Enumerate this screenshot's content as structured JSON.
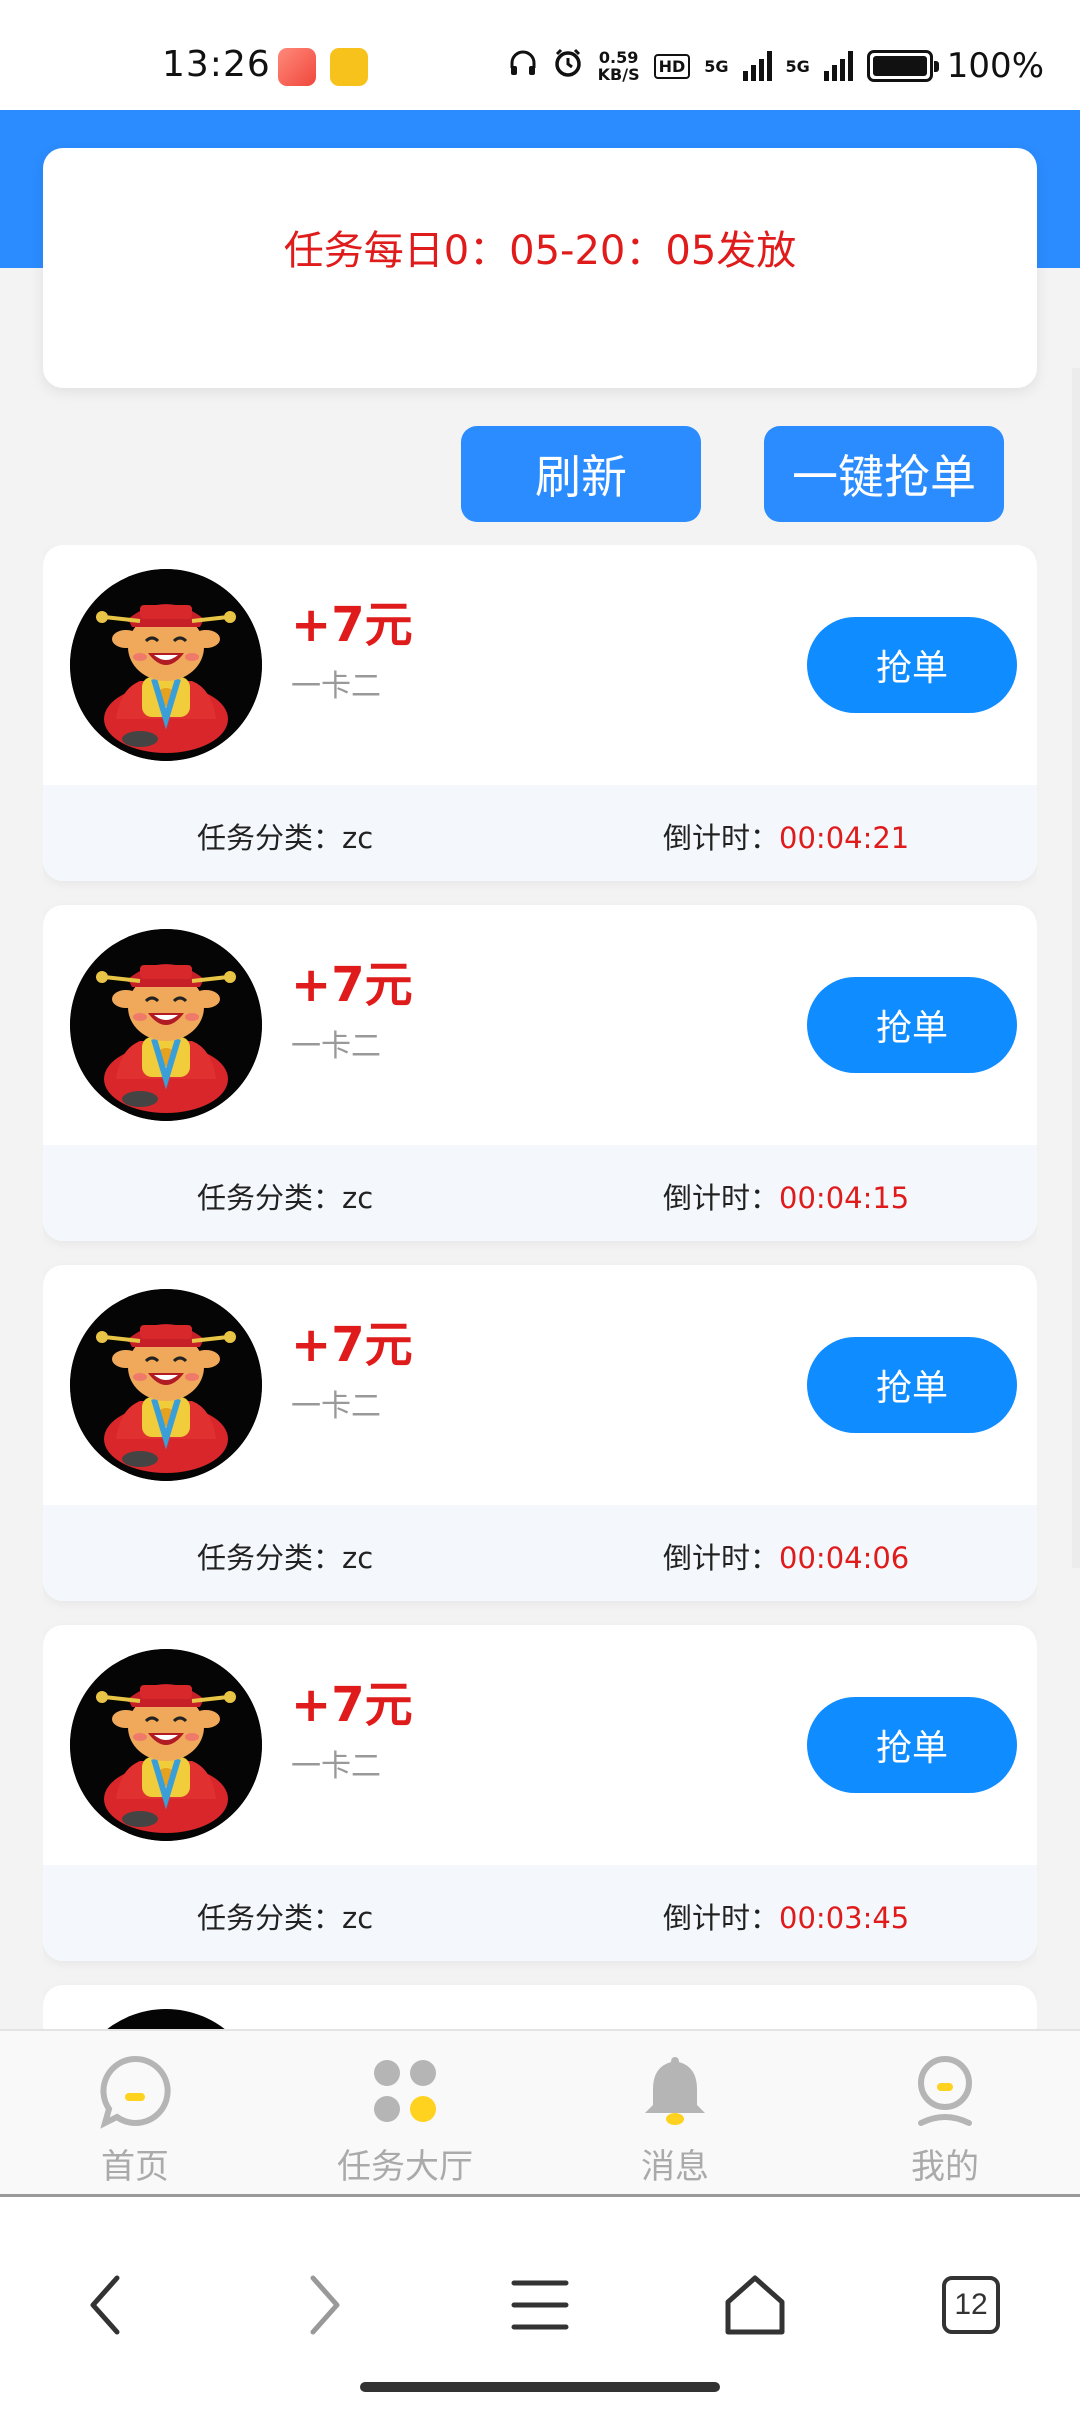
{
  "status_bar": {
    "time": "13:26",
    "network_speed_value": "0.59",
    "network_speed_unit": "KB/S",
    "hd_badge": "HD",
    "signal_1": "5G",
    "signal_2": "5G",
    "battery_percent": "100%"
  },
  "colors": {
    "primary_blue": "#2b8cff",
    "grab_blue": "#0f8cff",
    "accent_red": "#e01b1b",
    "hall_dot_yellow": "#ffd21f"
  },
  "notice": {
    "text": "任务每日0：05-20：05发放"
  },
  "actions": {
    "refresh_label": "刷新",
    "grab_all_label": "一键抢单"
  },
  "tasks": [
    {
      "reward": "+7元",
      "subtitle": "一卡二",
      "grab_label": "抢单",
      "category_label": "任务分类：",
      "category_value": "zc",
      "countdown_label": "倒计时：",
      "countdown_value": "00:04:21"
    },
    {
      "reward": "+7元",
      "subtitle": "一卡二",
      "grab_label": "抢单",
      "category_label": "任务分类：",
      "category_value": "zc",
      "countdown_label": "倒计时：",
      "countdown_value": "00:04:15"
    },
    {
      "reward": "+7元",
      "subtitle": "一卡二",
      "grab_label": "抢单",
      "category_label": "任务分类：",
      "category_value": "zc",
      "countdown_label": "倒计时：",
      "countdown_value": "00:04:06"
    },
    {
      "reward": "+7元",
      "subtitle": "一卡二",
      "grab_label": "抢单",
      "category_label": "任务分类：",
      "category_value": "zc",
      "countdown_label": "倒计时：",
      "countdown_value": "00:03:45"
    }
  ],
  "tabbar": {
    "items": [
      {
        "label": "首页",
        "icon": "chat-bubble-icon"
      },
      {
        "label": "任务大厅",
        "icon": "task-hall-icon"
      },
      {
        "label": "消息",
        "icon": "bell-icon"
      },
      {
        "label": "我的",
        "icon": "profile-icon"
      }
    ]
  },
  "system_nav": {
    "tabs_count": "12"
  }
}
